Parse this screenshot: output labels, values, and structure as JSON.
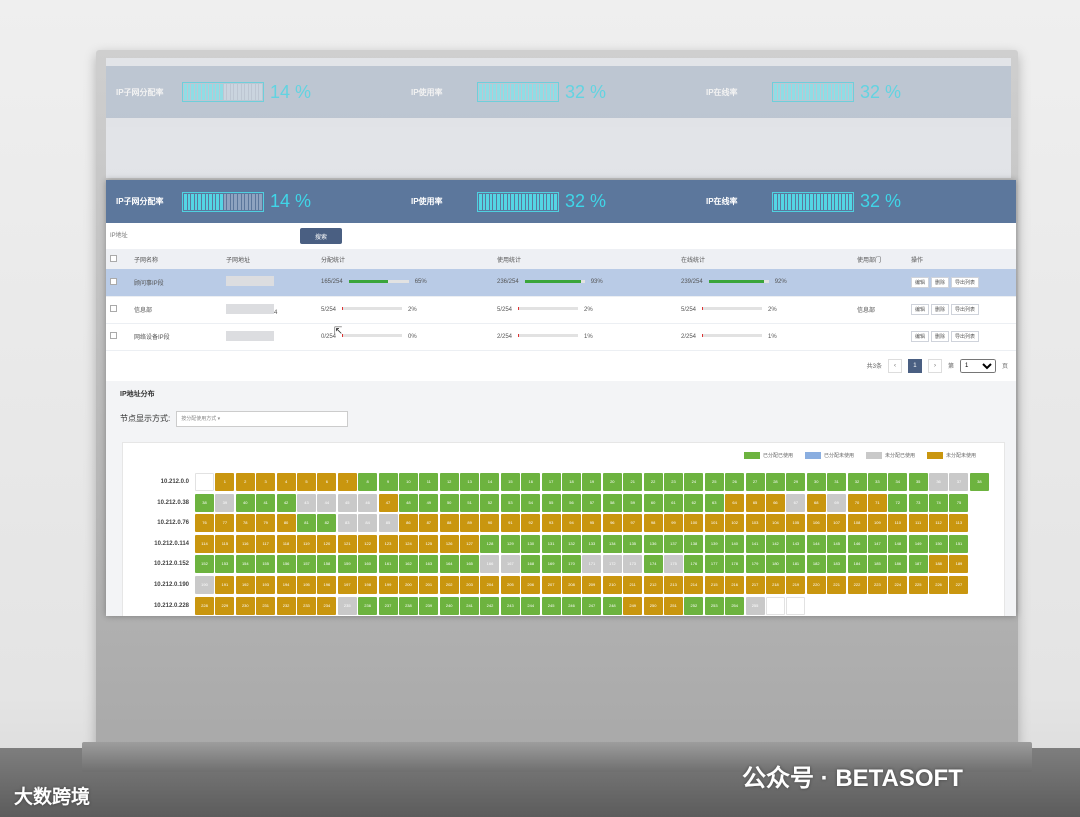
{
  "stats": [
    {
      "label": "IP子网分配率",
      "value": "14 %",
      "level": 0.14
    },
    {
      "label": "IP使用率",
      "value": "32 %",
      "level": 0.32
    },
    {
      "label": "IP在线率",
      "value": "32 %",
      "level": 0.32
    }
  ],
  "search": {
    "placeholder": "IP地址",
    "button": "搜索"
  },
  "table": {
    "headers": [
      "子网名称",
      "子网地址",
      "分配统计",
      "使用统计",
      "在线统计",
      "使用部门",
      "操作"
    ],
    "rows": [
      {
        "name": "顾问事IP段",
        "address": "",
        "alloc": "165/254",
        "alloc_pct": "65%",
        "alloc_level": 0.65,
        "use": "236/254",
        "use_pct": "93%",
        "use_level": 0.93,
        "online": "239/254",
        "online_pct": "92%",
        "online_level": 0.92,
        "dept": "",
        "selected": true
      },
      {
        "name": "信息部",
        "address": "4",
        "alloc": "5/254",
        "alloc_pct": "2%",
        "alloc_level": 0.02,
        "use": "5/254",
        "use_pct": "2%",
        "use_level": 0.02,
        "online": "5/254",
        "online_pct": "2%",
        "online_level": 0.02,
        "dept": "信息部",
        "selected": false
      },
      {
        "name": "网络设备IP段",
        "address": "",
        "alloc": "0/254",
        "alloc_pct": "0%",
        "alloc_level": 0.0,
        "use": "2/254",
        "use_pct": "1%",
        "use_level": 0.01,
        "online": "2/254",
        "online_pct": "1%",
        "online_level": 0.01,
        "dept": "",
        "selected": false
      }
    ],
    "actions": [
      "编辑",
      "删除",
      "导出列表"
    ]
  },
  "pager": {
    "total": "共3条",
    "prev": "‹",
    "current": "1",
    "next": "›",
    "page_label": "第",
    "page_value": "1",
    "page_unit": "页"
  },
  "distribution": {
    "title": "IP地址分布",
    "mode_label": "节点显示方式:",
    "mode_value": "按分配使用方式",
    "legend": [
      {
        "label": "已分配已使用",
        "color": "#6db33f"
      },
      {
        "label": "已分配未使用",
        "color": "#8aaee0"
      },
      {
        "label": "未分配已使用",
        "color": "#c9c9c9"
      },
      {
        "label": "未分配未使用",
        "color": "#c9960f"
      }
    ],
    "rows": [
      {
        "label": "10.212.0.0",
        "start": 0,
        "pattern": "eggggggggggggggggggggggggggggggggggggg"
      },
      {
        "label": "10.212.0.38",
        "start": 38,
        "pattern": "gyyyyyyyggggggggggggggggggggggggggggggg"
      },
      {
        "label": "10.212.0.76",
        "start": 76,
        "pattern": "gggggggggggggggggggggggggggggggggggggg"
      },
      {
        "label": "10.212.0.114",
        "start": 114,
        "pattern": "gggggggggggggggggggggggggggggggggggggg"
      },
      {
        "label": "10.212.0.152",
        "start": 152,
        "pattern": "gggggggggggggggggggggggggggggggggggggg"
      },
      {
        "label": "10.212.0.190",
        "start": 190,
        "pattern": "yggggggggggggggggggggggggggggggggggggg"
      },
      {
        "label": "10.212.0.228",
        "start": 228,
        "pattern": "gggggggggggggggggggggggggggyeeeeeeeeee"
      }
    ]
  },
  "watermark": {
    "left": "大数跨境",
    "right": "公众号 · BETASOFT"
  }
}
